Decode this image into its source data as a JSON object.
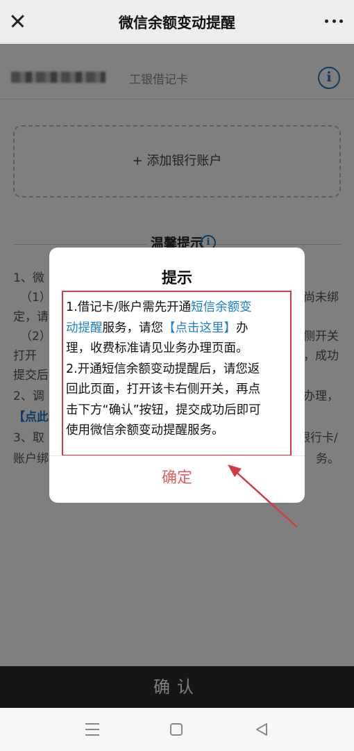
{
  "header": {
    "title": "微信余额变动提醒"
  },
  "card": {
    "type": "工银借记卡"
  },
  "add_bank_label": "+ 添加银行账户",
  "tips": {
    "title": "温馨提示",
    "lines": [
      "1、微",
      "（1）",
      "尚未绑",
      "定，请",
      "（2）",
      "侧开关",
      "打开",
      "，成功",
      "提交后",
      "2、调",
      "办理，",
      "【点此",
      "3、取",
      "银行卡/",
      "账户绑",
      "务。"
    ]
  },
  "confirm_bar_label": "确认",
  "dialog": {
    "title": "提示",
    "line1_prefix": "1.借记卡/账户需先开通",
    "line1_link": "短信余额变",
    "line2_link": "动提醒",
    "line2_mid": "服务，请您",
    "line2_link2": "【点击这里】",
    "line2_suffix": "办",
    "line3": "理，收费标准请见业务办理页面。",
    "line4": "2.开通短信余额变动提醒后，请您返",
    "line5": "回此页面，打开该卡右侧开关，再点",
    "line6": "击下方“确认”按钮，提交成功后即可",
    "line7": "使用微信余额变动提醒服务。",
    "ok_label": "确定"
  },
  "colors": {
    "link": "#1e7fd0",
    "annotation": "#d23a44",
    "ok_text": "#e0605e"
  }
}
